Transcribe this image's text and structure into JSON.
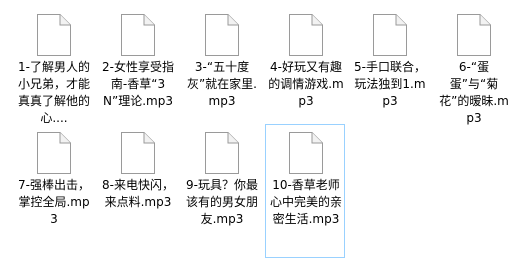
{
  "files": [
    {
      "label": "1-了解男人的小兄弟，才能真真了解他的心....",
      "icon": "document-icon"
    },
    {
      "label": "2-女性享受指南-香草“3N”理论.mp3",
      "icon": "document-icon"
    },
    {
      "label": "3-“五十度灰”就在家里.mp3",
      "icon": "document-icon"
    },
    {
      "label": "4-好玩又有趣的调情游戏.mp3",
      "icon": "document-icon"
    },
    {
      "label": "5-手口联合，玩法独到1.mp3",
      "icon": "document-icon"
    },
    {
      "label": "6-“蛋蛋”与“菊花”的暧昧.mp3",
      "icon": "document-icon"
    },
    {
      "label": "7-强棒出击，掌控全局.mp3",
      "icon": "document-icon"
    },
    {
      "label": "8-来电快闪，来点料.mp3",
      "icon": "document-icon"
    },
    {
      "label": "9-玩具？你最该有的男女朋友.mp3",
      "icon": "document-icon"
    },
    {
      "label": "10-香草老师心中完美的亲密生活.mp3",
      "icon": "document-icon",
      "selected": true
    }
  ]
}
